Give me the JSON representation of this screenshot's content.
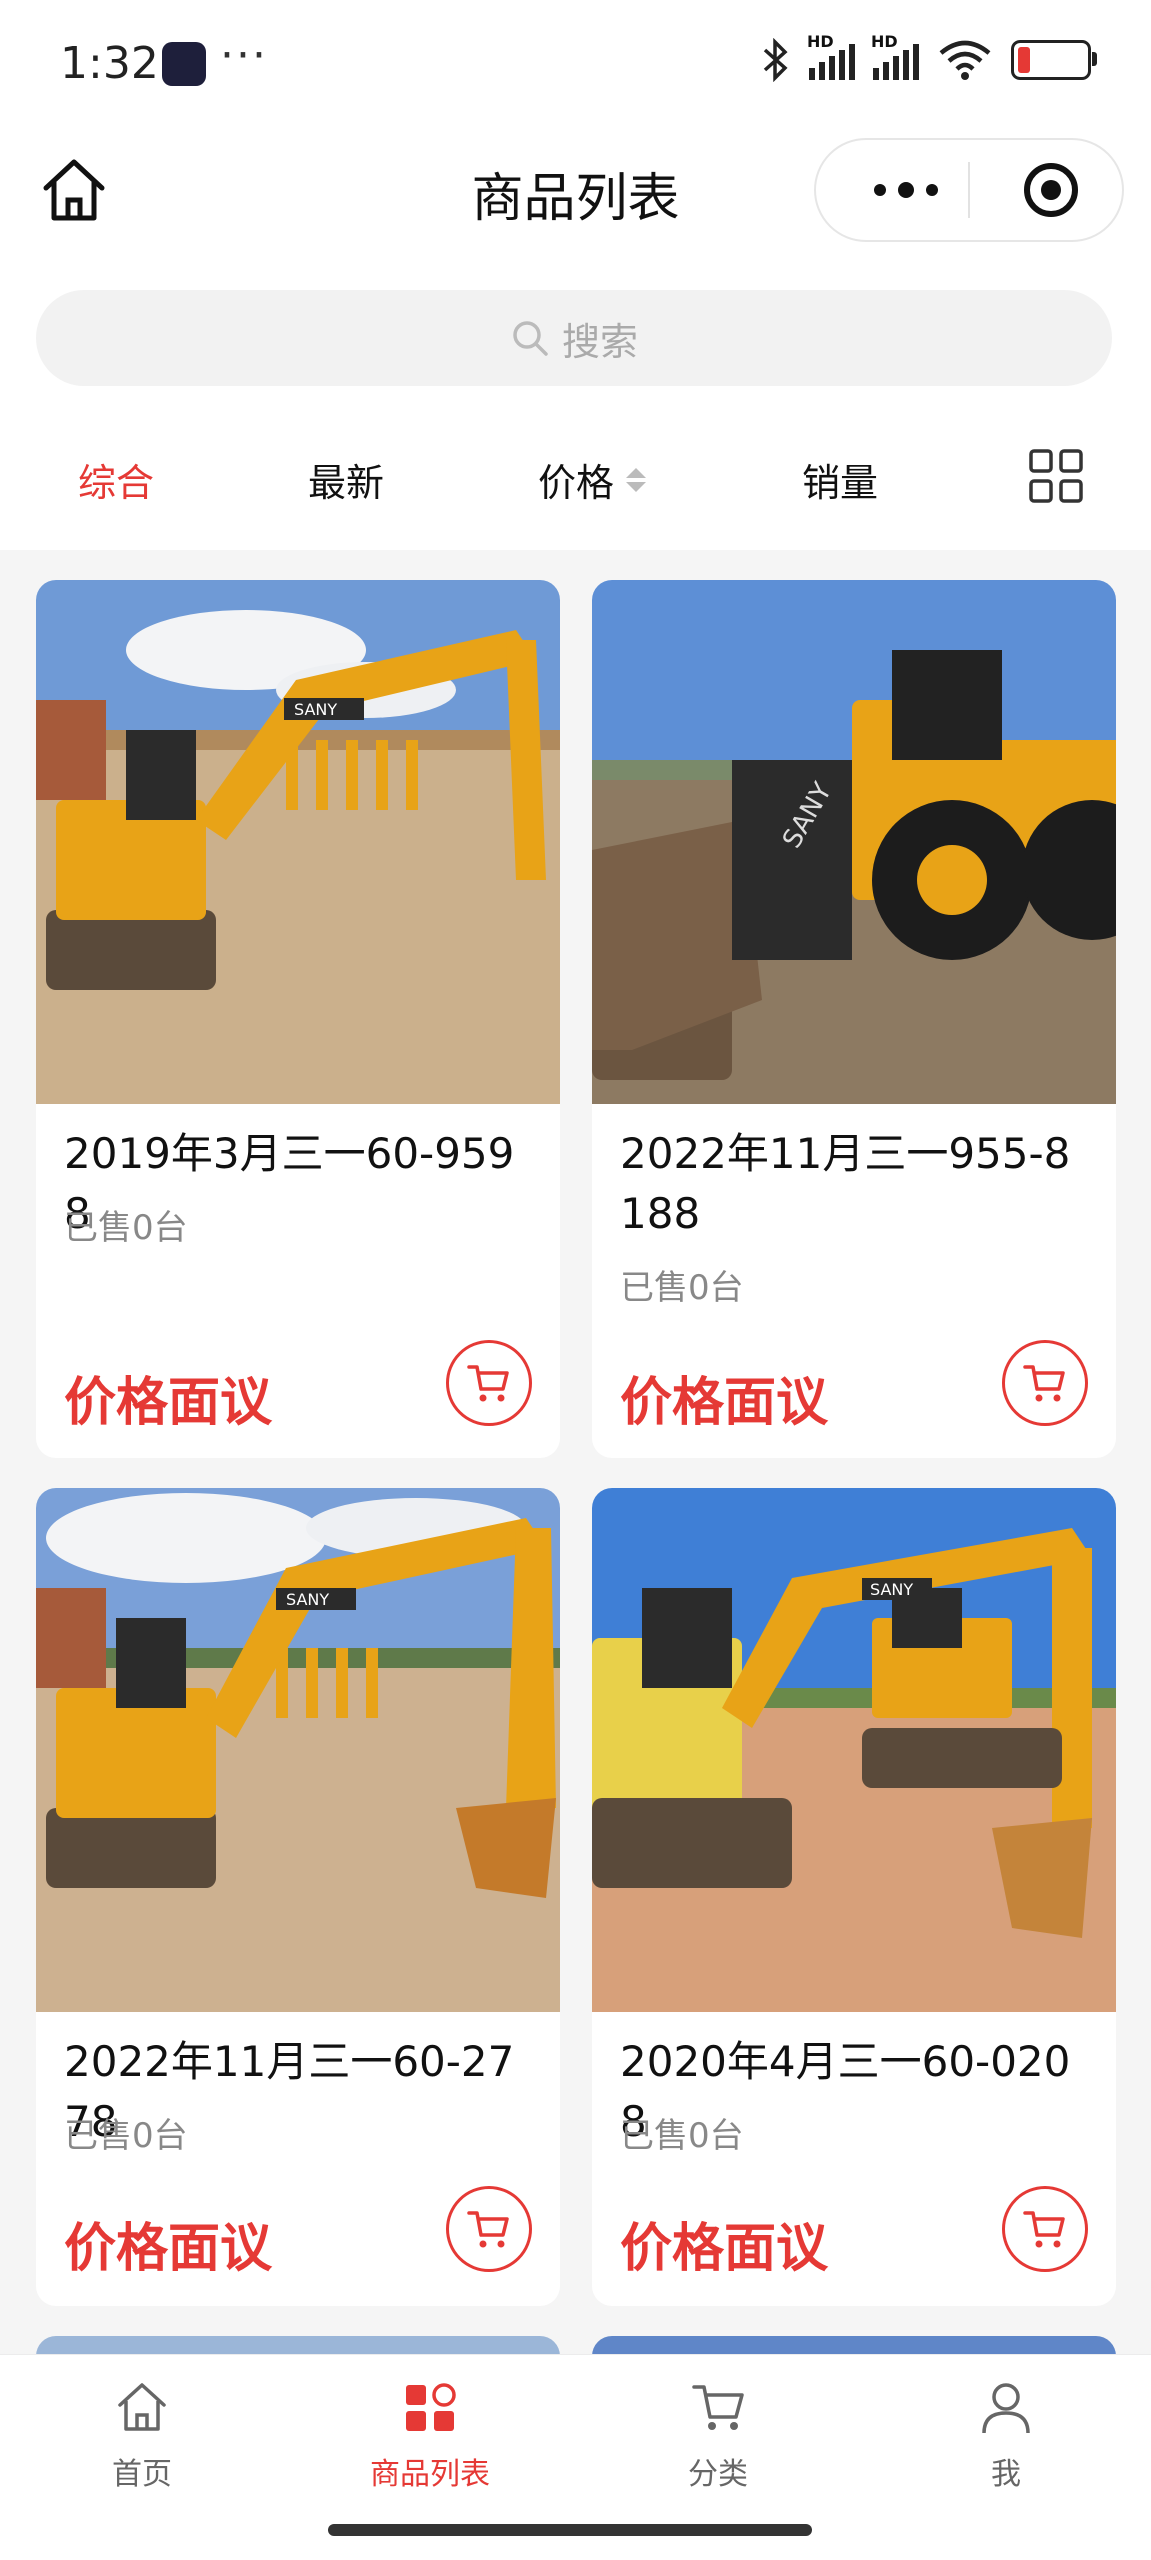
{
  "status_bar": {
    "time": "1:32",
    "dots": "···",
    "signal_label_1": "HD",
    "signal_label_2": "HD"
  },
  "nav": {
    "title": "商品列表"
  },
  "search": {
    "placeholder": "搜索"
  },
  "filters": [
    {
      "label": "综合",
      "active": true
    },
    {
      "label": "最新",
      "active": false
    },
    {
      "label": "价格",
      "active": false
    },
    {
      "label": "销量",
      "active": false
    }
  ],
  "products": [
    {
      "title": "2019年3月三一60-9598",
      "sold": "已售0台",
      "price": "价格面议"
    },
    {
      "title": "2022年11月三一955-8188",
      "sold": "已售0台",
      "price": "价格面议"
    },
    {
      "title": "2022年11月三一60-2778",
      "sold": "已售0台",
      "price": "价格面议"
    },
    {
      "title": "2020年4月三一60-0208",
      "sold": "已售0台",
      "price": "价格面议"
    }
  ],
  "tabbar": [
    {
      "label": "首页",
      "icon": "home-icon",
      "active": false
    },
    {
      "label": "商品列表",
      "icon": "grid-icon",
      "active": true
    },
    {
      "label": "分类",
      "icon": "cart-icon",
      "active": false
    },
    {
      "label": "我",
      "icon": "user-icon",
      "active": false
    }
  ],
  "colors": {
    "accent": "#e53935",
    "machine_yellow": "#e8a317",
    "sky": "#5d8fd6"
  }
}
